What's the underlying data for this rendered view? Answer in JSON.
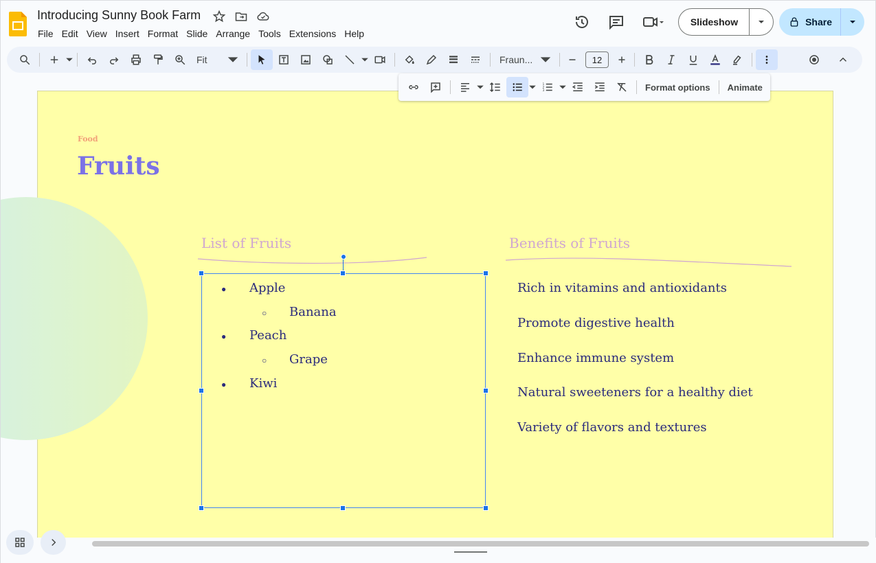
{
  "header": {
    "doc_title": "Introducing Sunny Book Farm",
    "menus": [
      "File",
      "Edit",
      "View",
      "Insert",
      "Format",
      "Slide",
      "Arrange",
      "Tools",
      "Extensions",
      "Help"
    ],
    "slideshow_label": "Slideshow",
    "share_label": "Share",
    "accent_color": "#c2e7ff"
  },
  "toolbar": {
    "zoom_value": "Fit",
    "font_name": "Fraun...",
    "font_size": "12"
  },
  "floating_toolbar": {
    "format_options_label": "Format options",
    "animate_label": "Animate"
  },
  "slide": {
    "kicker": "Food",
    "title": "Fruits",
    "left_heading": "List of Fruits",
    "right_heading": "Benefits of Fruits",
    "list_items": [
      {
        "text": "Apple",
        "level": 0
      },
      {
        "text": "Banana",
        "level": 1
      },
      {
        "text": "Peach",
        "level": 0
      },
      {
        "text": "Grape",
        "level": 1
      },
      {
        "text": "Kiwi",
        "level": 0
      }
    ],
    "benefits": [
      "Rich in vitamins and antioxidants",
      "Promote digestive health",
      "Enhance immune system",
      "Natural sweeteners for a healthy diet",
      "Variety of flavors and textures"
    ],
    "background_color": "#ffffa8",
    "title_color": "#7b72e6",
    "text_color": "#2b2b7c"
  },
  "icons": [
    "slides-logo-icon",
    "star-icon",
    "move-to-folder-icon",
    "cloud-saved-icon",
    "version-history-icon",
    "comments-icon",
    "meet-icon",
    "lock-icon",
    "chevron-down-icon",
    "search-icon",
    "new-slide-icon",
    "undo-icon",
    "redo-icon",
    "print-icon",
    "paint-format-icon",
    "zoom-icon",
    "select-icon",
    "text-box-icon",
    "image-icon",
    "shape-icon",
    "line-icon",
    "video-icon",
    "fill-color-icon",
    "border-color-icon",
    "border-weight-icon",
    "border-dash-icon",
    "bold-icon",
    "italic-icon",
    "underline-icon",
    "text-color-icon",
    "highlight-icon",
    "more-icon",
    "record-icon",
    "collapse-icon",
    "link-icon",
    "add-comment-icon",
    "align-icon",
    "line-spacing-icon",
    "bulleted-list-icon",
    "numbered-list-icon",
    "decrease-indent-icon",
    "increase-indent-icon",
    "clear-formatting-icon",
    "grid-view-icon",
    "chevron-right-icon"
  ]
}
